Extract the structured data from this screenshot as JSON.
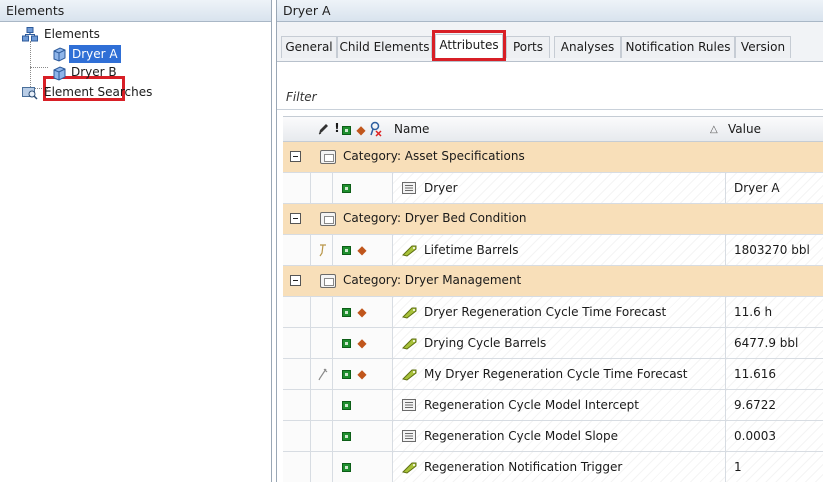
{
  "left_pane": {
    "title": "Elements",
    "tree": {
      "root": "Elements",
      "children": [
        "Dryer A",
        "Dryer B"
      ],
      "searches": "Element Searches"
    }
  },
  "right_pane": {
    "title": "Dryer A",
    "tabs": [
      {
        "label": "General",
        "active": false
      },
      {
        "label": "Child Elements",
        "active": false
      },
      {
        "label": "Attributes",
        "active": true
      },
      {
        "label": "Ports",
        "active": false
      },
      {
        "label": "Analyses",
        "active": false
      },
      {
        "label": "Notification Rules",
        "active": false
      },
      {
        "label": "Version",
        "active": false
      }
    ],
    "filter_label": "Filter",
    "grid": {
      "columns": {
        "name": "Name",
        "value": "Value"
      },
      "rows": [
        {
          "kind": "category",
          "label": "Category: Asset Specifications"
        },
        {
          "kind": "attribute",
          "name": "Dryer",
          "value": "Dryer A",
          "icon": "table-icon",
          "has_config": false
        },
        {
          "kind": "category",
          "label": "Category: Dryer Bed Condition"
        },
        {
          "kind": "attribute",
          "name": "Lifetime Barrels",
          "value": "1803270 bbl",
          "icon": "pi-tag-icon",
          "has_config": true
        },
        {
          "kind": "category",
          "label": "Category: Dryer Management"
        },
        {
          "kind": "attribute",
          "name": "Dryer  Regeneration Cycle Time Forecast",
          "value": "11.6 h",
          "icon": "pi-tag-icon",
          "has_config": true
        },
        {
          "kind": "attribute",
          "name": "Drying Cycle Barrels",
          "value": "6477.9 bbl",
          "icon": "pi-tag-icon",
          "has_config": true
        },
        {
          "kind": "attribute",
          "name": "My Dryer Regeneration Cycle Time Forecast",
          "value": "11.616",
          "icon": "pi-tag-icon",
          "has_config": true
        },
        {
          "kind": "attribute",
          "name": "Regeneration Cycle Model Intercept",
          "value": "9.6722",
          "icon": "table-icon",
          "has_config": false
        },
        {
          "kind": "attribute",
          "name": "Regeneration Cycle Model Slope",
          "value": "0.0003",
          "icon": "table-icon",
          "has_config": false
        },
        {
          "kind": "attribute",
          "name": "Regeneration Notification Trigger",
          "value": "1",
          "icon": "pi-tag-icon",
          "has_config": false
        }
      ]
    }
  },
  "colors": {
    "selection": "#2f6fd6",
    "highlight_box": "#d81f26",
    "category_row": "#f8dfb9"
  }
}
